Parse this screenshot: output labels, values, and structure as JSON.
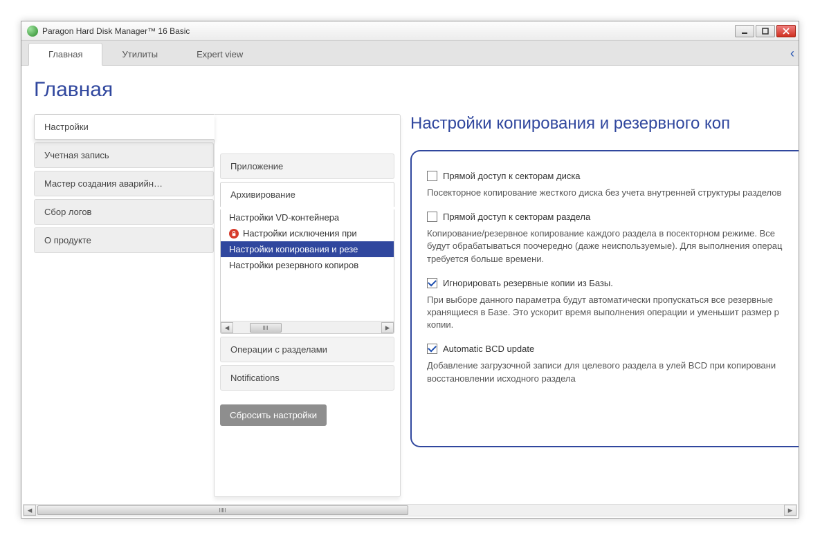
{
  "window": {
    "title": "Paragon Hard Disk Manager™ 16 Basic"
  },
  "tabs": {
    "main": "Главная",
    "utils": "Утилиты",
    "expert": "Expert view"
  },
  "page_title": "Главная",
  "leftnav": {
    "settings": "Настройки",
    "account": "Учетная запись",
    "rescue": "Мастер создания аварийн…",
    "logs": "Сбор логов",
    "about": "О продукте"
  },
  "accordion": {
    "app": "Приложение",
    "archive": "Архивирование",
    "archive_items": {
      "vd": "Настройки VD-контейнера",
      "exclude": "Настройки исключения при",
      "copy": "Настройки копирования и резе",
      "backup": "Настройки резервного копиров"
    },
    "partitions": "Операции с разделами",
    "notifications": "Notifications"
  },
  "reset_btn": "Сбросить настройки",
  "detail": {
    "title": "Настройки копирования и резервного коп",
    "chk1_label": "Прямой доступ к секторам диска",
    "chk1_desc": "Посекторное копирование жесткого диска без учета внутренней структуры разделов",
    "chk2_label": "Прямой доступ к секторам раздела",
    "chk2_desc_l1": "Копирование/резервное копирование каждого раздела в посекторном режиме. Все",
    "chk2_desc_l2": "будут обрабатываться поочередно (даже неиспользуемые). Для выполнения операц",
    "chk2_desc_l3": "требуется больше времени.",
    "chk3_label": "Игнорировать резервные копии из Базы.",
    "chk3_desc_l1": "При выборе данного параметра будут автоматически пропускаться все резервные",
    "chk3_desc_l2": "хранящиеся в Базе. Это ускорит время выполнения операции и уменьшит размер р",
    "chk3_desc_l3": "копии.",
    "chk4_label": "Automatic BCD update",
    "chk4_desc_l1": "Добавление загрузочной записи для целевого раздела в улей BCD при копировани",
    "chk4_desc_l2": "восстановлении исходного раздела"
  }
}
